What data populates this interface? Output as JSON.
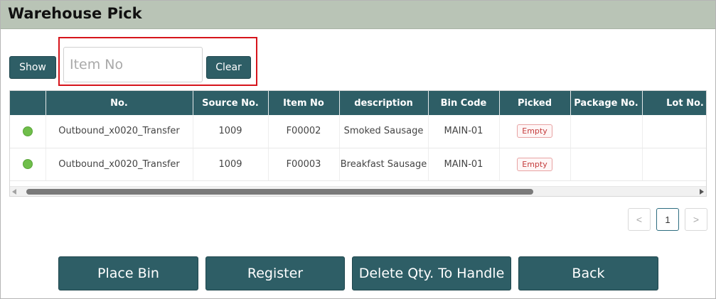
{
  "window": {
    "title": "Warehouse Pick"
  },
  "toolbar": {
    "show_label": "Show",
    "clear_label": "Clear",
    "search_placeholder": "Item No",
    "search_value": ""
  },
  "table": {
    "columns": [
      "",
      "No.",
      "Source No.",
      "Item No",
      "description",
      "Bin Code",
      "Picked",
      "Package No.",
      "Lot No."
    ],
    "rows": [
      {
        "status_color": "#6fbe4a",
        "no": "Outbound_x0020_Transfer",
        "source_no": "1009",
        "item_no": "F00002",
        "description": "Smoked Sausage",
        "bin_code": "MAIN-01",
        "picked": "Empty",
        "package_no": "",
        "lot_no": ""
      },
      {
        "status_color": "#6fbe4a",
        "no": "Outbound_x0020_Transfer",
        "source_no": "1009",
        "item_no": "F00003",
        "description": "Breakfast Sausage",
        "bin_code": "MAIN-01",
        "picked": "Empty",
        "package_no": "",
        "lot_no": ""
      }
    ]
  },
  "pager": {
    "prev": "<",
    "page": "1",
    "next": ">"
  },
  "actions": {
    "place_bin": "Place Bin",
    "register": "Register",
    "delete_qty": "Delete Qty. To Handle",
    "back": "Back"
  },
  "colors": {
    "accent": "#2e5e66",
    "titlebar": "#b9c4b6",
    "highlight": "#d6141b",
    "status_ok": "#6fbe4a"
  }
}
